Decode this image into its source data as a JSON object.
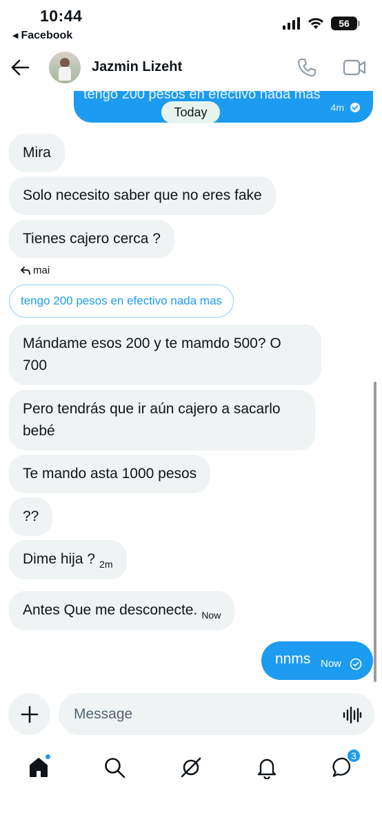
{
  "status_bar": {
    "time": "10:44",
    "back_app": "Facebook",
    "battery": "56"
  },
  "header": {
    "contact_name": "Jazmin Lizeht"
  },
  "chat": {
    "previous_sent": {
      "text": "tengo 200 pesos en efectivo nada mas",
      "time": "4m"
    },
    "date_separator": "Today",
    "messages_received": [
      {
        "text": "Mira"
      },
      {
        "text": "Solo necesito saber que no eres fake"
      },
      {
        "text": "Tienes cajero cerca ?"
      }
    ],
    "reply": {
      "label": "mai",
      "quoted_text": "tengo 200 pesos en efectivo nada mas"
    },
    "messages_after": [
      {
        "text": "Mándame esos 200 y te mamdo 500? O 700"
      },
      {
        "text": "Pero tendrás que ir aún cajero a sacarlo bebé"
      },
      {
        "text": "Te mando asta 1000 pesos"
      },
      {
        "text": "??"
      },
      {
        "text": "Dime hija  ?",
        "time": "2m"
      },
      {
        "text": "Antes Que me desconecte.",
        "time": "Now"
      }
    ],
    "sent_message": {
      "text": "nnms",
      "time": "Now"
    }
  },
  "composer": {
    "placeholder": "Message"
  },
  "bottom_nav": {
    "messages_badge": "3"
  },
  "colors": {
    "accent": "#1d9bf0",
    "bubble_received": "#eff3f4",
    "today_pill": "#e6f4ee"
  },
  "icons": [
    "back-arrow-icon",
    "phone-icon",
    "video-icon",
    "plus-icon",
    "voice-icon",
    "home-icon",
    "search-icon",
    "grok-icon",
    "bell-icon",
    "messages-icon",
    "check-circle-icon",
    "reply-arrow-icon"
  ]
}
